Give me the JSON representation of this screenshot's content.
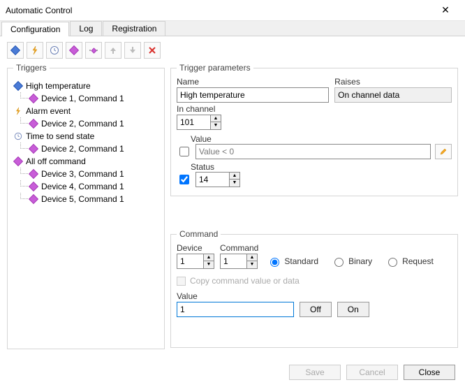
{
  "window": {
    "title": "Automatic Control"
  },
  "tabs": {
    "items": [
      "Configuration",
      "Log",
      "Registration"
    ],
    "active": 0
  },
  "toolbar_icons": [
    "diamond-blue",
    "bolt",
    "clock",
    "diamond-purple",
    "diamond-dots",
    "arrow-up",
    "arrow-down",
    "delete"
  ],
  "triggers": {
    "legend": "Triggers",
    "nodes": [
      {
        "icon": "diamond-blue",
        "label": "High temperature",
        "children": [
          {
            "icon": "diamond-purple",
            "label": "Device 1, Command 1"
          }
        ]
      },
      {
        "icon": "bolt",
        "label": "Alarm event",
        "children": [
          {
            "icon": "diamond-purple",
            "label": "Device 2, Command 1"
          }
        ]
      },
      {
        "icon": "clock",
        "label": "Time to send state",
        "children": [
          {
            "icon": "diamond-purple",
            "label": "Device 2, Command 1"
          }
        ]
      },
      {
        "icon": "diamond-purple",
        "label": "All off command",
        "children": [
          {
            "icon": "diamond-purple",
            "label": "Device 3, Command 1"
          },
          {
            "icon": "diamond-purple",
            "label": "Device 4, Command 1"
          },
          {
            "icon": "diamond-purple",
            "label": "Device 5, Command 1"
          }
        ]
      }
    ]
  },
  "params": {
    "legend": "Trigger parameters",
    "name_label": "Name",
    "name_value": "High temperature",
    "raises_label": "Raises",
    "raises_value": "On channel data",
    "in_channel_label": "In channel",
    "in_channel_value": "101",
    "value_label": "Value",
    "value_checked": false,
    "value_text": "Value < 0",
    "status_label": "Status",
    "status_checked": true,
    "status_value": "14"
  },
  "command": {
    "legend": "Command",
    "device_label": "Device",
    "device_value": "1",
    "command_label": "Command",
    "command_value": "1",
    "type_options": [
      "Standard",
      "Binary",
      "Request"
    ],
    "type_selected": 0,
    "copy_label": "Copy command value or data",
    "value_label": "Value",
    "value_value": "1",
    "off_label": "Off",
    "on_label": "On"
  },
  "footer": {
    "save": "Save",
    "cancel": "Cancel",
    "close": "Close"
  }
}
